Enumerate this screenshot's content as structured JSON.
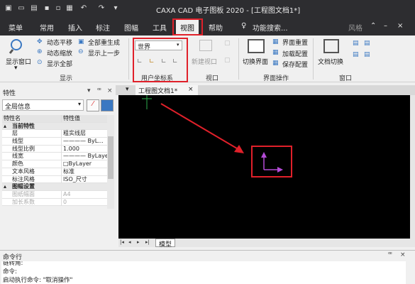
{
  "titlebar": {
    "title": "CAXA CAD 电子图板 2020 - [工程图文档1*]",
    "icons": [
      "new-file-icon",
      "open-folder-icon",
      "save-icon",
      "save-as-icon",
      "print-icon",
      "undo-icon",
      "redo-icon",
      "customize-qat-icon"
    ]
  },
  "menubar": {
    "items": [
      "菜单",
      "常用",
      "插入",
      "标注",
      "图幅",
      "工具",
      "视图",
      "帮助"
    ],
    "active": "视图",
    "search_label": "功能搜索...",
    "style_label": "风格"
  },
  "ribbon": {
    "display": {
      "big_button": "显示窗口",
      "items": [
        "动态平移",
        "动态缩放",
        "显示全部",
        "全部重生成",
        "显示上一步"
      ],
      "group": "显示"
    },
    "ucs": {
      "combo_value": "世界",
      "group": "用户坐标系"
    },
    "viewport": {
      "button": "新建视口",
      "group": "视口"
    },
    "interface": {
      "big_button": "切换界面",
      "items": [
        "界面重置",
        "加载配置",
        "保存配置"
      ],
      "group": "界面操作"
    },
    "window": {
      "big_button": "文档切换",
      "group": "窗口"
    }
  },
  "properties": {
    "title": "特性",
    "combo_value": "全局信息",
    "header": [
      "特性名",
      "特性值"
    ],
    "rows": [
      {
        "type": "section",
        "name": "当前特性"
      },
      {
        "name": "层",
        "value": "粗实线层"
      },
      {
        "name": "线型",
        "value": "———— ByL..."
      },
      {
        "name": "线型比例",
        "value": "1.000"
      },
      {
        "name": "线宽",
        "value": "———— ByLayer"
      },
      {
        "name": "颜色",
        "value": "□ByLayer"
      },
      {
        "name": "文本风格",
        "value": "标准"
      },
      {
        "name": "标注风格",
        "value": "ISO_尺寸"
      },
      {
        "type": "section",
        "name": "图幅设置"
      },
      {
        "name": "图纸幅面",
        "value": "A4",
        "dim": true
      },
      {
        "name": "加长系数",
        "value": "0",
        "dim": true
      }
    ]
  },
  "document": {
    "tab": "工程图文档1*",
    "sheet_tab": "模型"
  },
  "command": {
    "title": "命令行",
    "lines": [
      "链转角:",
      "命令:",
      "启动执行命令: \"取消操作\""
    ]
  },
  "colors": {
    "chrome": "#2d2d30",
    "highlight": "#e0202a",
    "canvas": "#000000",
    "ucs_icon": "#b44bd6"
  }
}
